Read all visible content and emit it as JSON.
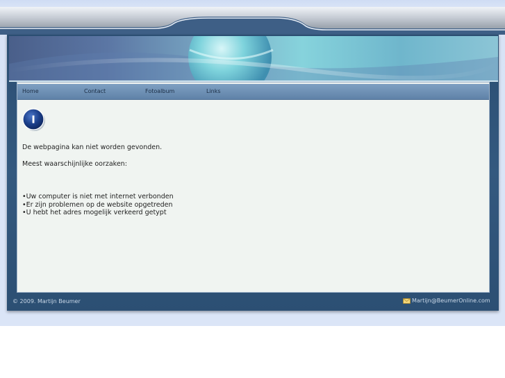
{
  "nav": {
    "items": [
      {
        "label": "Home"
      },
      {
        "label": "Contact"
      },
      {
        "label": "Fotoalbum"
      },
      {
        "label": "Links"
      }
    ]
  },
  "info_icon": {
    "glyph": "I",
    "icon": "info-icon",
    "color": "#1b3f8a"
  },
  "message": {
    "title": "De webpagina kan niet worden gevonden.",
    "causes_heading": "Meest waarschijnlijke oorzaken:",
    "causes": [
      "•Uw computer is niet met internet verbonden",
      "•Er zijn problemen op de website opgetreden",
      "•U hebt het adres mogelijk verkeerd getypt"
    ]
  },
  "footer": {
    "copyright": "© 2009. Martijn Beumer",
    "email": "Martijn@BeumerOnline.com",
    "email_icon": "envelope-icon"
  },
  "colors": {
    "frame": "#2b4e72",
    "navbar": "#6f91b5",
    "content_bg": "#f0f4f1"
  }
}
